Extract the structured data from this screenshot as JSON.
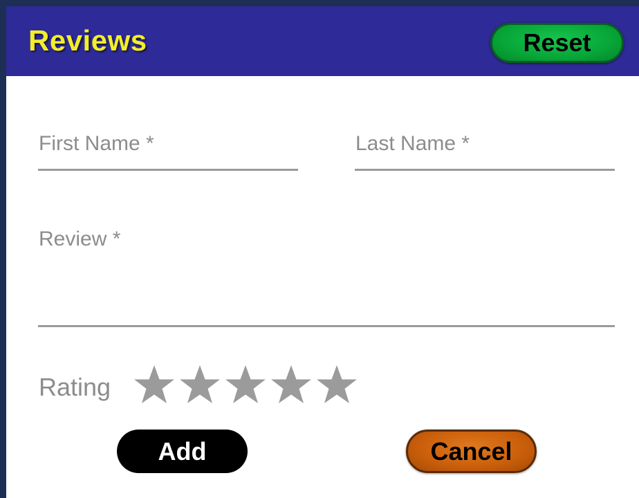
{
  "header": {
    "title": "Reviews",
    "reset_label": "Reset"
  },
  "form": {
    "first_name": {
      "label": "First Name *",
      "value": ""
    },
    "last_name": {
      "label": "Last Name *",
      "value": ""
    },
    "review": {
      "label": "Review *",
      "value": ""
    },
    "rating": {
      "label": "Rating",
      "max_stars": 5,
      "selected": 0
    }
  },
  "actions": {
    "add_label": "Add",
    "cancel_label": "Cancel"
  },
  "colors": {
    "header_bg": "#2e2a97",
    "title": "#f2ee2a",
    "reset_bg": "#07a638",
    "cancel_bg": "#c95e0a",
    "add_bg": "#000000",
    "star_empty": "#9b9b9b"
  },
  "icons": {
    "star": "star-icon"
  }
}
